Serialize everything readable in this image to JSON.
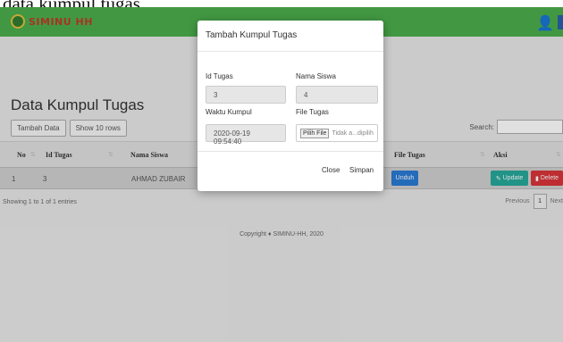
{
  "caption_fragment": "data kumpul tugas.",
  "navbar": {
    "brand": "SIMINU HH",
    "bg_color": "#4cae4c"
  },
  "page": {
    "title": "Data Kumpul Tugas",
    "buttons": {
      "add": "Tambah Data",
      "show_rows": "Show 10 rows"
    },
    "search_label": "Search:"
  },
  "table": {
    "headers": [
      "No",
      "Id Tugas",
      "Nama Siswa",
      "File Tugas",
      "Aksi"
    ],
    "rows": [
      {
        "no": "1",
        "id_tugas": "3",
        "nama_siswa": "AHMAD ZUBAIR",
        "file_button": "Unduh",
        "update_button": "Update",
        "delete_button": "Delete"
      }
    ]
  },
  "footer": {
    "entries": "Showing 1 to 1 of 1 entries",
    "prev": "Previous",
    "page": "1",
    "next": "Next",
    "copyright": "Copyright ♦ SIMINU-HH, 2020"
  },
  "modal": {
    "title": "Tambah Kumpul Tugas",
    "labels": {
      "id_tugas": "Id Tugas",
      "nama_siswa": "Nama Siswa",
      "waktu_kumpul": "Waktu Kumpul",
      "file_tugas": "File Tugas"
    },
    "values": {
      "id_tugas": "3",
      "nama_siswa": "4",
      "waktu_kumpul": "2020-09-19 09:54:40"
    },
    "file_button": "Pilih File",
    "file_status": "Tidak a...dipilih",
    "close": "Close",
    "save": "Simpan"
  },
  "colors": {
    "unduh": "#2a7ad4",
    "update": "#27a89a",
    "delete": "#d9343a"
  }
}
